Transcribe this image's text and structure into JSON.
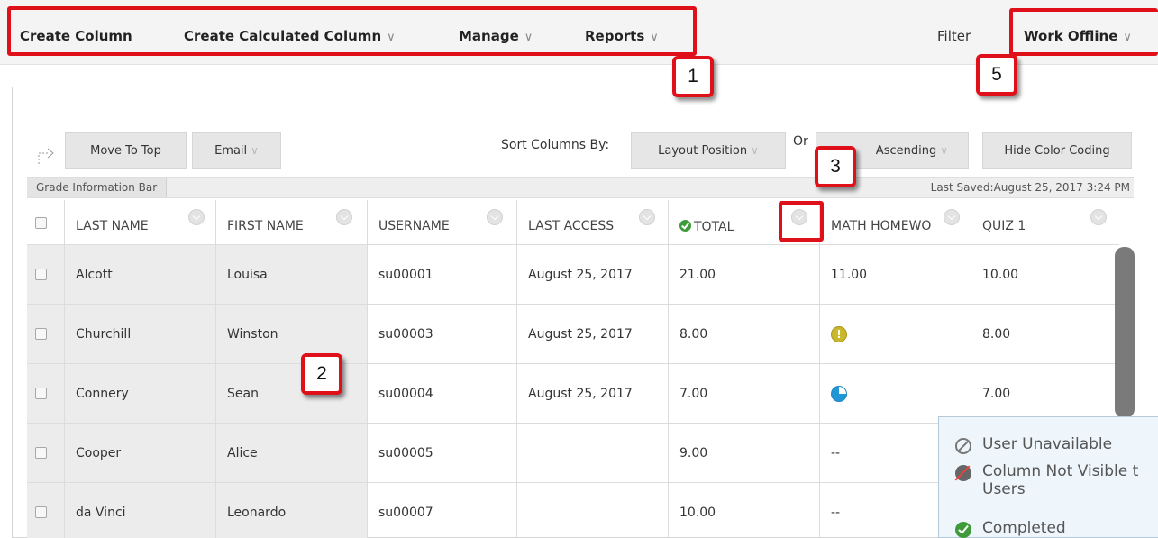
{
  "action_bar": {
    "create_column": "Create Column",
    "create_calculated_column": "Create Calculated Column",
    "manage": "Manage",
    "reports": "Reports",
    "filter": "Filter",
    "work_offline": "Work Offline",
    "chevron": "∨"
  },
  "callouts": [
    "1",
    "2",
    "3",
    "5"
  ],
  "toolbar": {
    "move_to_top": "Move To Top",
    "email": "Email",
    "sort_columns_by": "Sort Columns By:",
    "layout_position": "Layout Position",
    "order": "Or",
    "ascending": "Ascending",
    "hide_color_coding": "Hide Color Coding"
  },
  "info_bar": {
    "tab": "Grade Information Bar",
    "last_saved": "Last Saved:August 25, 2017 3:24 PM"
  },
  "columns": [
    "LAST NAME",
    "FIRST NAME",
    "USERNAME",
    "LAST ACCESS",
    "TOTAL",
    "MATH HOMEWO",
    "QUIZ 1"
  ],
  "rows": [
    {
      "last": "Alcott",
      "first": "Louisa",
      "user": "su00001",
      "access": "August 25, 2017",
      "total": "21.00",
      "math": "11.00",
      "quiz": "10.00"
    },
    {
      "last": "Churchill",
      "first": "Winston",
      "user": "su00003",
      "access": "August 25, 2017",
      "total": "8.00",
      "math_icon": "needs-grading-icon",
      "quiz": "8.00"
    },
    {
      "last": "Connery",
      "first": "Sean",
      "user": "su00004",
      "access": "August 25, 2017",
      "total": "7.00",
      "math_icon": "in-progress-icon",
      "quiz": "7.00"
    },
    {
      "last": "Cooper",
      "first": "Alice",
      "user": "su00005",
      "access": "",
      "total": "9.00",
      "math": "--",
      "quiz": ""
    },
    {
      "last": "da Vinci",
      "first": "Leonardo",
      "user": "su00007",
      "access": "",
      "total": "10.00",
      "math": "--",
      "quiz": ""
    }
  ],
  "legend": {
    "user_unavailable": "User Unavailable",
    "column_not_visible_line1": "Column Not Visible t",
    "column_not_visible_line2": "Users",
    "completed": "Completed"
  },
  "colors": {
    "callout_red": "#e0101a",
    "completed_green": "#3f9b3a",
    "progress_blue": "#2196d6",
    "attention_yellow": "#c9b82a"
  }
}
